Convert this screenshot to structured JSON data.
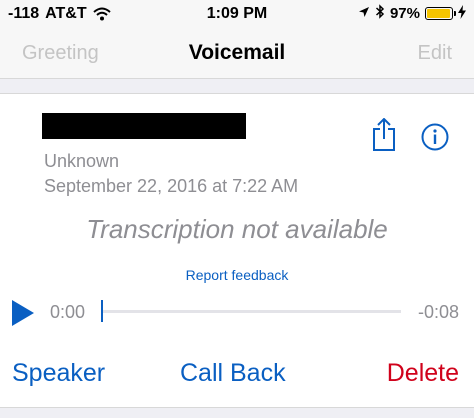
{
  "status_bar": {
    "signal": "-118",
    "carrier": "AT&T",
    "time": "1:09 PM",
    "battery_percent": "97%",
    "battery_level": 0.97,
    "icons": [
      "wifi-icon",
      "location-arrow-icon",
      "bluetooth-icon",
      "battery-icon",
      "charging-bolt-icon"
    ]
  },
  "nav": {
    "left_label": "Greeting",
    "title": "Voicemail",
    "right_label": "Edit"
  },
  "voicemail": {
    "caller": "Unknown",
    "date": "September 22, 2016 at 7:22 AM",
    "transcription": "Transcription not available",
    "feedback_link": "Report feedback",
    "time_elapsed": "0:00",
    "time_remaining": "-0:08",
    "progress": 0
  },
  "actions": {
    "speaker": "Speaker",
    "call_back": "Call Back",
    "delete": "Delete"
  },
  "colors": {
    "accent": "#0a5fc2",
    "destructive": "#d0021b",
    "secondary_text": "#8e8e93",
    "disabled_nav": "#c4c4c4",
    "battery": "#f5c400"
  }
}
